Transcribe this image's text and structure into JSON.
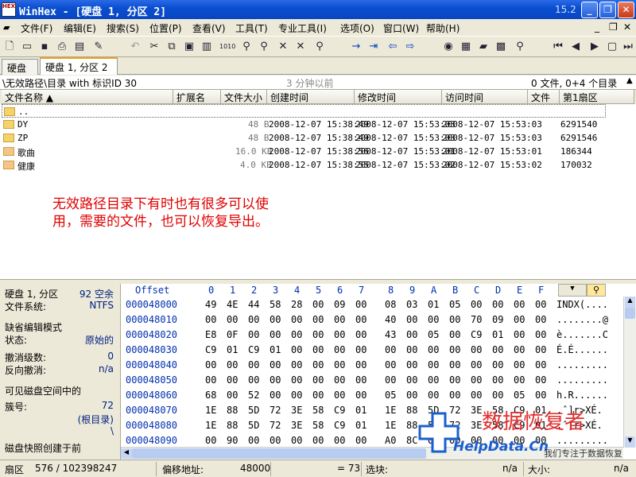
{
  "window": {
    "logo_text": "HEX",
    "title": "WinHex - [硬盘 1, 分区 2]",
    "version": "15.2",
    "btn_min": "_",
    "btn_max": "❐",
    "btn_close": "✕"
  },
  "menu": [
    "文件(F)",
    "编辑(E)",
    "搜索(S)",
    "位置(P)",
    "查看(V)",
    "工具(T)",
    "专业工具(I)",
    "选项(O)",
    "窗口(W)",
    "帮助(H)"
  ],
  "tabs": [
    "硬盘 1",
    "硬盘 1, 分区 2"
  ],
  "pathbar": {
    "path": "\\无效路径\\目录 with 标识ID 30",
    "time": "3 分钟以前",
    "count": "0 文件, 0+4 个目录"
  },
  "list": {
    "headers": [
      "文件名称 ▲",
      "扩展名",
      "文件大小",
      "创建时间",
      "修改时间",
      "访问时间",
      "文件",
      "第1扇区"
    ],
    "rows": [
      {
        "name": "..",
        "size": "",
        "created": "",
        "modified": "",
        "accessed": "",
        "sector": "",
        "type": "folder"
      },
      {
        "name": "DY",
        "size": "48 B",
        "created": "2008-12-07  15:38:49",
        "modified": "2008-12-07  15:53:03",
        "accessed": "2008-12-07  15:53:03",
        "sector": "6291540",
        "type": "folder"
      },
      {
        "name": "ZP",
        "size": "48 B",
        "created": "2008-12-07  15:38:49",
        "modified": "2008-12-07  15:53:03",
        "accessed": "2008-12-07  15:53:03",
        "sector": "6291546",
        "type": "folder"
      },
      {
        "name": "歌曲",
        "size": "16.0 KB",
        "created": "2008-12-07  15:38:56",
        "modified": "2008-12-07  15:53:01",
        "accessed": "2008-12-07  15:53:01",
        "sector": "186344",
        "type": "xfolder"
      },
      {
        "name": "健康",
        "size": "4.0 KB",
        "created": "2008-12-07  15:38:55",
        "modified": "2008-12-07  15:53:02",
        "accessed": "2008-12-07  15:53:02",
        "sector": "170032",
        "type": "xfolder"
      }
    ]
  },
  "annotation": {
    "line1": "无效路径目录下有时也有很多可以使",
    "line2": "用，需要的文件，也可以恢复导出。"
  },
  "info": {
    "disk": "硬盘 1, 分区",
    "disk_free": "92 空余",
    "fs_label": "文件系统:",
    "fs": "NTFS",
    "edit_mode_label": "缺省编辑模式",
    "state_label": "状态:",
    "state": "原始的",
    "undo_label": "撤消级数:",
    "undo": "0",
    "redo_label": "反向撤消:",
    "redo": "n/a",
    "visible_label": "可见磁盘空间中的",
    "cluster_label": "簇号:",
    "cluster": "72",
    "root": "(根目录)",
    "slash": "\\",
    "snapshot": "磁盘快照创建于前"
  },
  "hex": {
    "offset_label": "Offset",
    "columns": [
      "0",
      "1",
      "2",
      "3",
      "4",
      "5",
      "6",
      "7",
      "8",
      "9",
      "A",
      "B",
      "C",
      "D",
      "E",
      "F"
    ],
    "rows": [
      {
        "off": "000048000",
        "b": [
          "49",
          "4E",
          "44",
          "58",
          "28",
          "00",
          "09",
          "00",
          "08",
          "03",
          "01",
          "05",
          "00",
          "00",
          "00",
          "00"
        ],
        "a": "INDX(...."
      },
      {
        "off": "000048010",
        "b": [
          "00",
          "00",
          "00",
          "00",
          "00",
          "00",
          "00",
          "00",
          "40",
          "00",
          "00",
          "00",
          "70",
          "09",
          "00",
          "00"
        ],
        "a": "........@"
      },
      {
        "off": "000048020",
        "b": [
          "E8",
          "0F",
          "00",
          "00",
          "00",
          "00",
          "00",
          "00",
          "43",
          "00",
          "05",
          "00",
          "C9",
          "01",
          "00",
          "00"
        ],
        "a": "è.......C"
      },
      {
        "off": "000048030",
        "b": [
          "C9",
          "01",
          "C9",
          "01",
          "00",
          "00",
          "00",
          "00",
          "00",
          "00",
          "00",
          "00",
          "00",
          "00",
          "00",
          "00"
        ],
        "a": "É.É......"
      },
      {
        "off": "000048040",
        "b": [
          "00",
          "00",
          "00",
          "00",
          "00",
          "00",
          "00",
          "00",
          "00",
          "00",
          "00",
          "00",
          "00",
          "00",
          "00",
          "00"
        ],
        "a": "........."
      },
      {
        "off": "000048050",
        "b": [
          "00",
          "00",
          "00",
          "00",
          "00",
          "00",
          "00",
          "00",
          "00",
          "00",
          "00",
          "00",
          "00",
          "00",
          "00",
          "00"
        ],
        "a": "........."
      },
      {
        "off": "000048060",
        "b": [
          "68",
          "00",
          "52",
          "00",
          "00",
          "00",
          "00",
          "00",
          "05",
          "00",
          "00",
          "00",
          "00",
          "00",
          "05",
          "00"
        ],
        "a": "h.R......"
      },
      {
        "off": "000048070",
        "b": [
          "1E",
          "88",
          "5D",
          "72",
          "3E",
          "58",
          "C9",
          "01",
          "1E",
          "88",
          "5D",
          "72",
          "3E",
          "58",
          "C9",
          "01"
        ],
        "a": ".ˆ]r>XÉ."
      },
      {
        "off": "000048080",
        "b": [
          "1E",
          "88",
          "5D",
          "72",
          "3E",
          "58",
          "C9",
          "01",
          "1E",
          "88",
          "5D",
          "72",
          "3E",
          "58",
          "C9",
          "01"
        ],
        "a": ".ˆ]r>XÉ."
      },
      {
        "off": "000048090",
        "b": [
          "00",
          "90",
          "00",
          "00",
          "00",
          "00",
          "00",
          "00",
          "A0",
          "8C",
          "00",
          "00",
          "00",
          "00",
          "00",
          "00"
        ],
        "a": "........."
      }
    ]
  },
  "status": {
    "sector_label": "扇区",
    "sector": "576 / 102398247",
    "offset_label": "偏移地址:",
    "offset": "48000",
    "eq": "= 73",
    "block_label": "选块:",
    "block": "n/a",
    "size_label": "大小:",
    "size": "n/a"
  },
  "watermark": {
    "cn": "数据恢复者",
    "site": "HelpData.Cn",
    "slogan": "我们专注于数据恢复"
  },
  "colors": {
    "accent": "#0a4fd0",
    "annotation": "#e00000",
    "hex_offset": "#0030b0",
    "watermark_blue": "#1a5fd0"
  }
}
